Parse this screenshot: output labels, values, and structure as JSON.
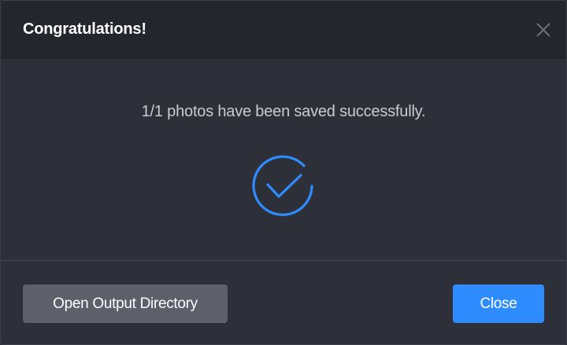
{
  "dialog": {
    "title": "Congratulations!",
    "message": "1/1 photos have been saved successfully.",
    "open_output_label": "Open Output Directory",
    "close_label": "Close"
  },
  "icons": {
    "close": "close-icon",
    "success": "check-circle-icon"
  },
  "colors": {
    "accent": "#2f8cff",
    "titlebar": "#24262d",
    "body": "#2e3039",
    "secondary_button": "#5d606b"
  }
}
